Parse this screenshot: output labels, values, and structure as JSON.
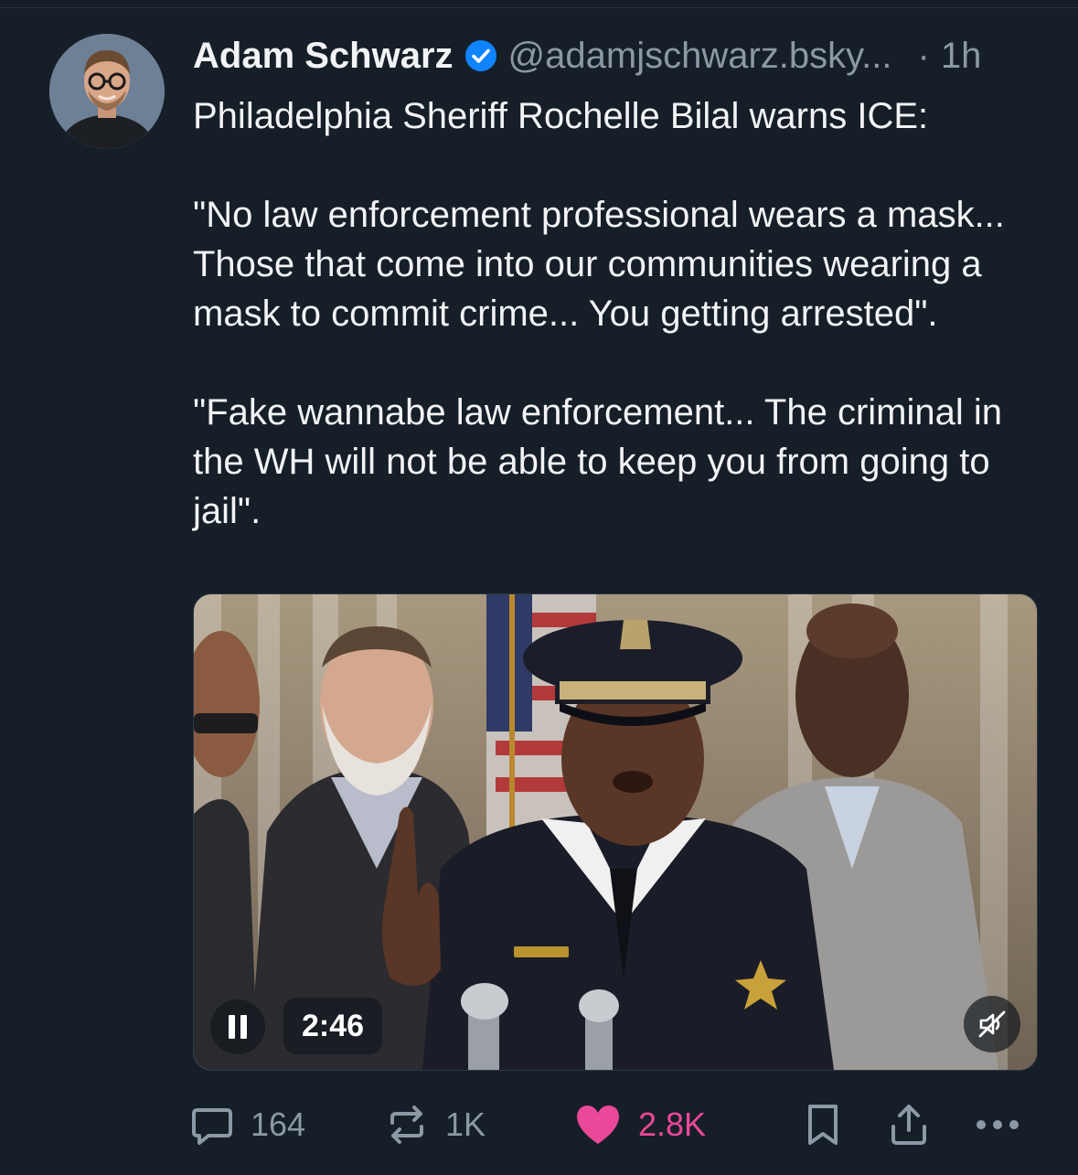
{
  "post": {
    "author_name": "Adam Schwarz",
    "handle": "@adamjschwarz.bsky...",
    "separator": "·",
    "timestamp": "1h",
    "text_lines": {
      "intro": "Philadelphia Sheriff Rochelle Bilal warns ICE:",
      "quote1": "\"No law enforcement professional wears a mask... Those that come into our communities wearing a mask to commit crime... You getting arrested\".",
      "quote2": "\"Fake wannabe law enforcement... The criminal in the WH will not be able to keep you from going to jail\"."
    }
  },
  "video": {
    "time_remaining": "2:46",
    "state": "playing",
    "muted": true
  },
  "actions": {
    "replies": "164",
    "reposts": "1K",
    "likes": "2.8K",
    "liked": true
  },
  "colors": {
    "background": "#161e27",
    "text_primary": "#f1f3f5",
    "text_secondary": "#8b98a5",
    "verified_blue": "#1083fe",
    "like_pink": "#ec4899"
  },
  "icons": {
    "verified": "verified-badge-icon",
    "pause": "pause-icon",
    "mute": "speaker-muted-icon",
    "reply": "speech-bubble-icon",
    "repost": "repost-arrows-icon",
    "like": "heart-icon",
    "bookmark": "bookmark-icon",
    "share": "share-upload-icon",
    "more": "more-dots-icon"
  }
}
